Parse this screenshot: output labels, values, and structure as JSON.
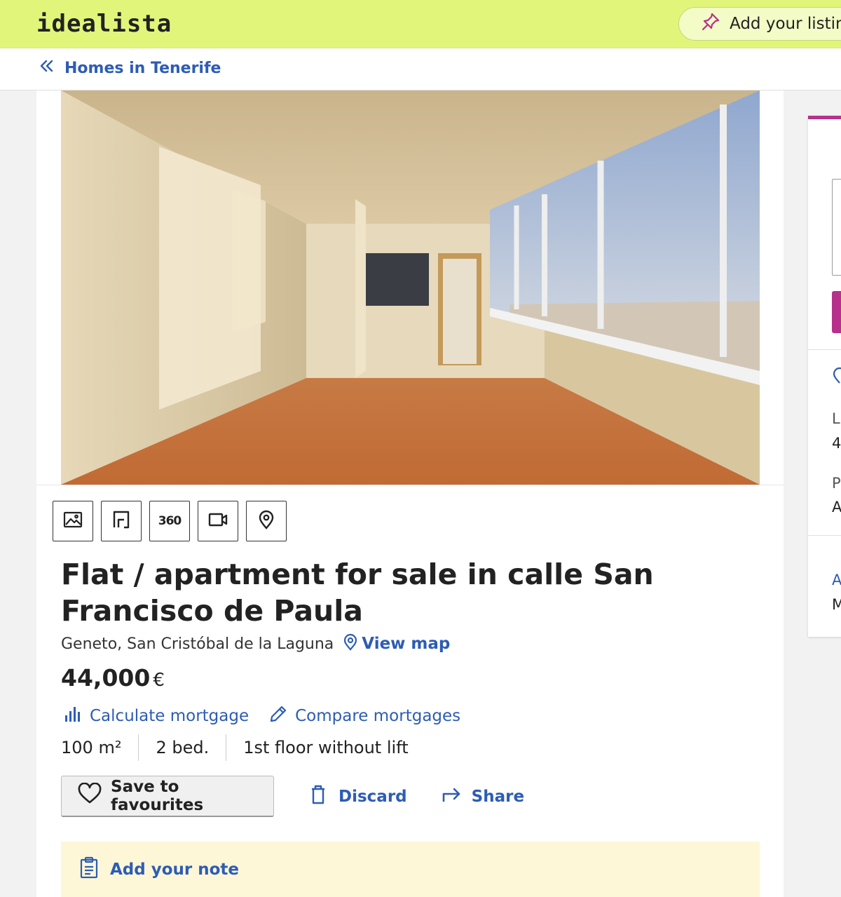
{
  "header": {
    "logo": "idealista",
    "add_listing_label": "Add your listin"
  },
  "breadcrumb": {
    "label": "Homes in Tenerife"
  },
  "listing": {
    "title": "Flat / apartment for sale in calle San Francisco de Paula",
    "location": "Geneto, San Cristóbal de la Laguna",
    "view_map_label": "View map",
    "price": "44,000",
    "currency": "€",
    "calculate_mortgage_label": "Calculate mortgage",
    "compare_mortgages_label": "Compare mortgages",
    "features": [
      "100 m²",
      "2 bed.",
      "1st floor without lift"
    ],
    "save_label": "Save to favourites",
    "discard_label": "Discard",
    "share_label": "Share",
    "note_label": "Add your note"
  },
  "media_buttons": [
    {
      "icon": "photos-icon"
    },
    {
      "icon": "floor-plan-icon"
    },
    {
      "icon": "360-icon",
      "label": "360"
    },
    {
      "icon": "video-icon"
    },
    {
      "icon": "map-pin-icon"
    }
  ],
  "sidebar": {
    "line1_label": "L",
    "line1_value": "4",
    "line2_label": "P",
    "line2_value": "A",
    "line3_label": "A",
    "line3_value": "M"
  },
  "colors": {
    "header_bg": "#e1f57a",
    "link_blue": "#2d5cb5",
    "brand_magenta": "#b7308b",
    "note_bg": "#fdf7d8"
  }
}
